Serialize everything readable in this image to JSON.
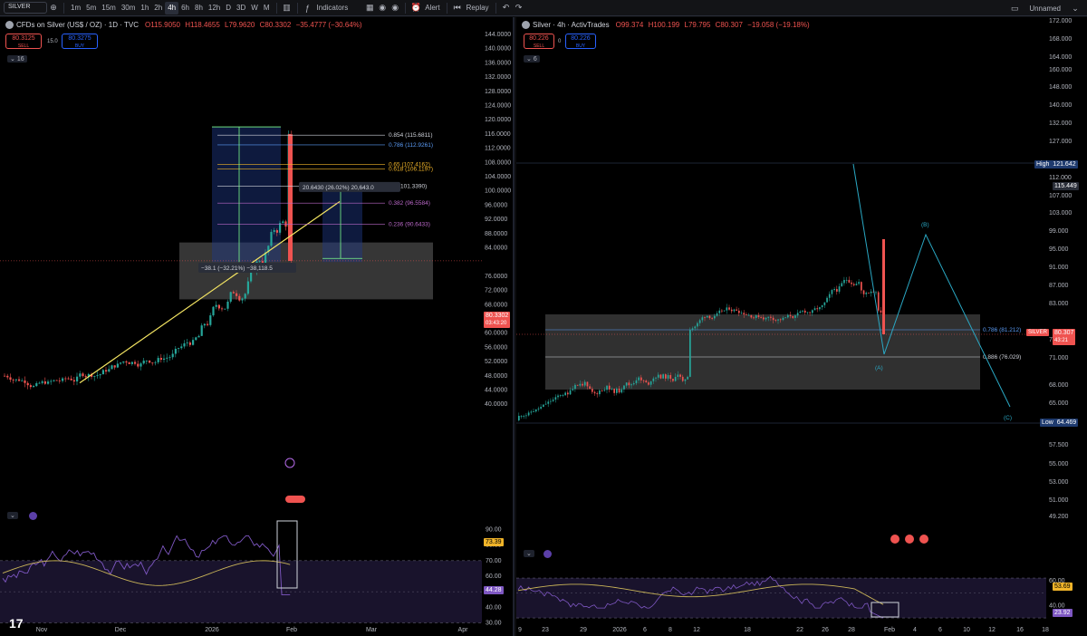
{
  "toolbar": {
    "symbol": "SILVER",
    "intervals": [
      "1m",
      "5m",
      "15m",
      "30m",
      "1h",
      "2h",
      "4h",
      "6h",
      "8h",
      "12h",
      "D",
      "3D",
      "W",
      "M"
    ],
    "active_interval": "4h",
    "indicators_label": "Indicators",
    "alert_label": "Alert",
    "replay_label": "Replay",
    "layout_name": "Unnamed",
    "colors": {
      "accent": "#2962ff",
      "down": "#ef5350",
      "up": "#26a69a"
    }
  },
  "left": {
    "title": "CFDs on Silver (US$ / OZ) · 1D · TVC",
    "ohlc": {
      "o": "O115.9050",
      "h": "H118.4655",
      "l": "L79.9620",
      "c": "C80.3302",
      "chg": "−35.4777 (−30.64%)"
    },
    "sell_price": "80.3125",
    "sell_label": "SELL",
    "spread": "15.0",
    "buy_price": "80.3275",
    "buy_label": "BUY",
    "indicator_count": "16",
    "price_ticks": [
      "144.0000",
      "140.0000",
      "136.0000",
      "132.0000",
      "128.0000",
      "124.0000",
      "120.0000",
      "116.0000",
      "112.0000",
      "108.0000",
      "104.0000",
      "100.0000",
      "96.0000",
      "92.0000",
      "88.0000",
      "84.0000",
      "76.0000",
      "72.0000",
      "68.0000",
      "64.0000",
      "60.0000",
      "56.0000",
      "52.0000",
      "48.0000",
      "44.0000",
      "40.0000"
    ],
    "last_price": "80.3302",
    "countdown": "03:43:20",
    "time_ticks": [
      "Nov",
      "Dec",
      "2026",
      "Feb",
      "Mar",
      "Apr"
    ],
    "fib_levels": [
      {
        "label": "0.854 (115.6811)",
        "color": "#d1d4dc"
      },
      {
        "label": "0.786 (112.9261)",
        "color": "#5b9cf6"
      },
      {
        "label": "0.65 (107.4162)",
        "color": "#f0b429"
      },
      {
        "label": "0.618 (106.1197)",
        "color": "#f0b429"
      },
      {
        "label": "0.5 (101.3390)",
        "color": "#d1d4dc"
      },
      {
        "label": "0.382 (96.5584)",
        "color": "#ba68c8"
      },
      {
        "label": "0.236 (90.6433)",
        "color": "#ba68c8"
      }
    ],
    "measure_up": "20.6430 (26.02%) 20,643.0",
    "measure_down": "−38.1 (−32.21%) −38,118.5",
    "rsi_ticks": [
      "90.00",
      "80.00",
      "70.00",
      "60.00",
      "50.00",
      "40.00",
      "30.00"
    ],
    "rsi_value": "73.39",
    "rsi_ma_value": "44.28"
  },
  "right": {
    "title": "Silver · 4h · ActivTrades",
    "ohlc": {
      "o": "O99.374",
      "h": "H100.199",
      "l": "L79.795",
      "c": "C80.307",
      "chg": "−19.058 (−19.18%)"
    },
    "sell_price": "80.226",
    "sell_label": "SELL",
    "spread": "0",
    "buy_price": "80.226",
    "buy_label": "BUY",
    "indicator_count": "6",
    "price_ticks": [
      "172.000",
      "168.000",
      "164.000",
      "160.000",
      "148.000",
      "140.000",
      "132.000",
      "127.000",
      "112.000",
      "107.000",
      "103.000",
      "99.000",
      "95.000",
      "91.000",
      "87.000",
      "83.000",
      "74.000",
      "71.000",
      "68.000",
      "65.000",
      "61.000",
      "57.500",
      "55.000",
      "53.000",
      "51.000",
      "49.200"
    ],
    "high_label": "High",
    "high_value": "121.642",
    "prev_value": "115.449",
    "symbol_tag": "SILVER",
    "last_price": "80.307",
    "countdown": "43:21",
    "low_label": "Low",
    "low_value": "64.469",
    "fib_786": "0.786 (81.212)",
    "fib_886": "0.886 (76.029)",
    "wave_a": "(A)",
    "wave_b": "(B)",
    "wave_c": "(C)",
    "time_ticks": [
      "9",
      "23",
      "29",
      "2026",
      "6",
      "8",
      "12",
      "18",
      "22",
      "26",
      "28",
      "Feb",
      "4",
      "6",
      "10",
      "12",
      "16",
      "18"
    ],
    "rsi_ticks": [
      "60.00",
      "40.00"
    ],
    "rsi_value": "53.69",
    "rsi_ma_value": "23.92"
  }
}
